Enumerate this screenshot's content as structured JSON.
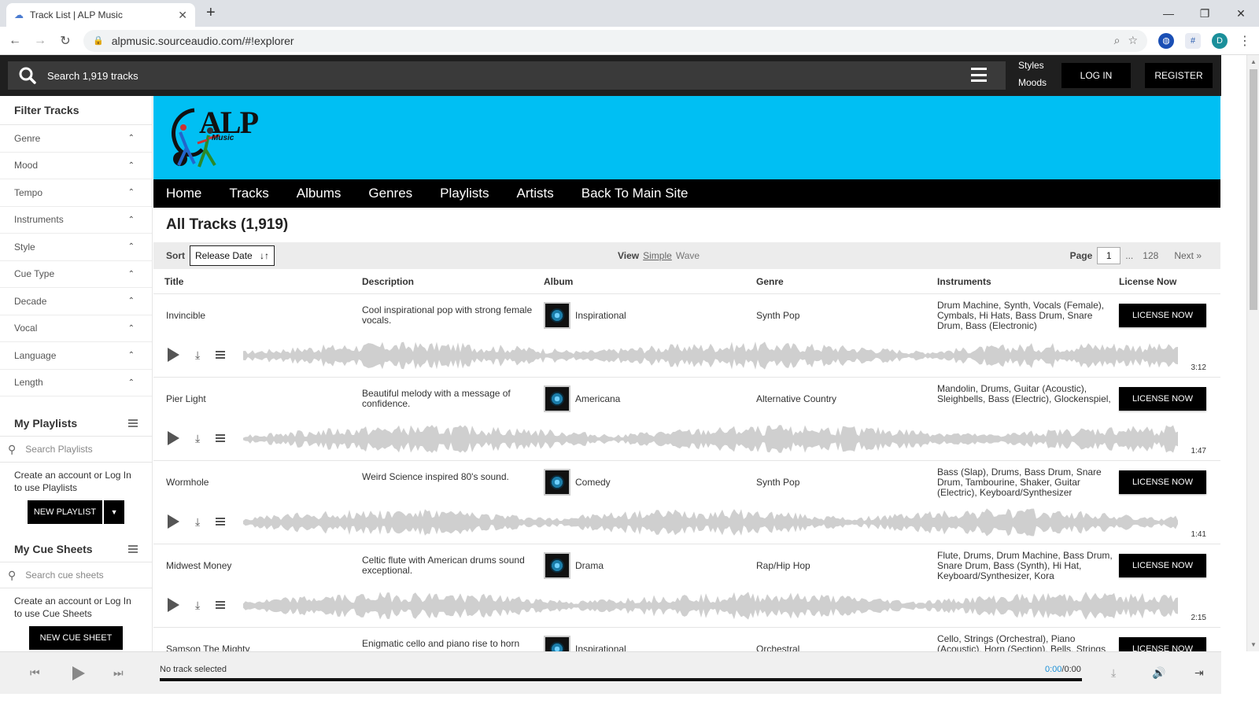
{
  "browser": {
    "tab_title": "Track List | ALP Music",
    "url": "alpmusic.sourceaudio.com/#!explorer",
    "profile_initial": "D"
  },
  "topbar": {
    "search_placeholder": "Search 1,919 tracks",
    "styles": "Styles",
    "moods": "Moods",
    "login": "LOG IN",
    "register": "REGISTER"
  },
  "sidebar": {
    "filter_heading": "Filter Tracks",
    "filters": [
      "Genre",
      "Mood",
      "Tempo",
      "Instruments",
      "Style",
      "Cue Type",
      "Decade",
      "Vocal",
      "Language",
      "Length"
    ],
    "playlists": {
      "heading": "My Playlists",
      "search_placeholder": "Search Playlists",
      "note": "Create an account or Log In to use Playlists",
      "button": "NEW PLAYLIST"
    },
    "cuesheets": {
      "heading": "My Cue Sheets",
      "search_placeholder": "Search cue sheets",
      "note": "Create an account or Log In to use Cue Sheets",
      "button": "NEW CUE SHEET"
    }
  },
  "banner": {
    "logo_text": "ALP",
    "logo_sub": "Music"
  },
  "nav": [
    "Home",
    "Tracks",
    "Albums",
    "Genres",
    "Playlists",
    "Artists",
    "Back To Main Site"
  ],
  "main": {
    "title": "All Tracks (1,919)",
    "sort_label": "Sort",
    "sort_value": "Release Date",
    "view_label": "View",
    "view_simple": "Simple",
    "view_wave": "Wave",
    "page_label": "Page",
    "page_value": "1",
    "page_ellipsis": "...",
    "page_last": "128",
    "page_next": "Next »"
  },
  "columns": {
    "title": "Title",
    "description": "Description",
    "album": "Album",
    "genre": "Genre",
    "instruments": "Instruments",
    "license": "License Now"
  },
  "tracks": [
    {
      "title": "Invincible",
      "description": "Cool inspirational pop with strong female vocals.",
      "album": "Inspirational",
      "genre": "Synth Pop",
      "instruments": "Drum Machine, Synth, Vocals (Female), Cymbals, Hi Hats, Bass Drum, Snare Drum, Bass (Electronic)",
      "duration": "3:12",
      "license": "LICENSE NOW"
    },
    {
      "title": "Pier Light",
      "description": "Beautiful melody with a message of confidence.",
      "album": "Americana",
      "genre": "Alternative Country",
      "instruments": "Mandolin, Drums, Guitar (Acoustic), Sleighbells, Bass (Electric), Glockenspiel,",
      "duration": "1:47",
      "license": "LICENSE NOW"
    },
    {
      "title": "Wormhole",
      "description": "Weird Science inspired 80's sound.",
      "album": "Comedy",
      "genre": "Synth Pop",
      "instruments": "Bass (Slap), Drums, Bass Drum, Snare Drum, Tambourine, Shaker, Guitar (Electric), Keyboard/Synthesizer",
      "duration": "1:41",
      "license": "LICENSE NOW"
    },
    {
      "title": "Midwest Money",
      "description": "Celtic flute with American drums sound exceptional.",
      "album": "Drama",
      "genre": "Rap/Hip Hop",
      "instruments": "Flute, Drums, Drum Machine, Bass Drum, Snare Drum, Bass (Synth), Hi Hat, Keyboard/Synthesizer, Kora",
      "duration": "2:15",
      "license": "LICENSE NOW"
    },
    {
      "title": "Samson The Mighty",
      "description": "Enigmatic cello and piano rise to horn",
      "album": "Inspirational",
      "genre": "Orchestral",
      "instruments": "Cello, Strings (Orchestral), Piano (Acoustic), Horn (Section), Bells, Strings",
      "duration": "",
      "license": "LICENSE NOW"
    }
  ],
  "player": {
    "status": "No track selected",
    "current_time": "0:00",
    "total_time": "/0:00"
  }
}
